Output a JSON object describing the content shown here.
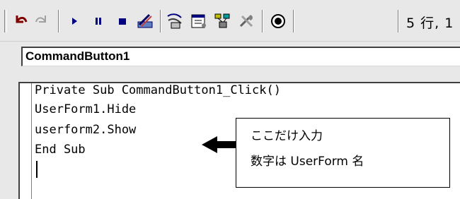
{
  "toolbar": {
    "icons": [
      "undo-icon",
      "redo-icon",
      "run-icon",
      "pause-icon",
      "stop-icon",
      "design-mode-icon",
      "project-explorer-icon",
      "properties-icon",
      "object-browser-icon",
      "toolbox-icon",
      "help-icon"
    ],
    "position_text": "5 行, 1"
  },
  "object_box": {
    "value": "CommandButton1"
  },
  "code": {
    "lines": [
      "Private Sub CommandButton1_Click()",
      "UserForm1.Hide",
      "userform2.Show",
      "End Sub"
    ]
  },
  "callout": {
    "line1": "ここだけ入力",
    "line2": "数字は UserForm 名"
  },
  "colors": {
    "toolbar_bg": "#e8e8e8",
    "icon_blue": "#0000a0",
    "icon_red": "#b00000"
  }
}
